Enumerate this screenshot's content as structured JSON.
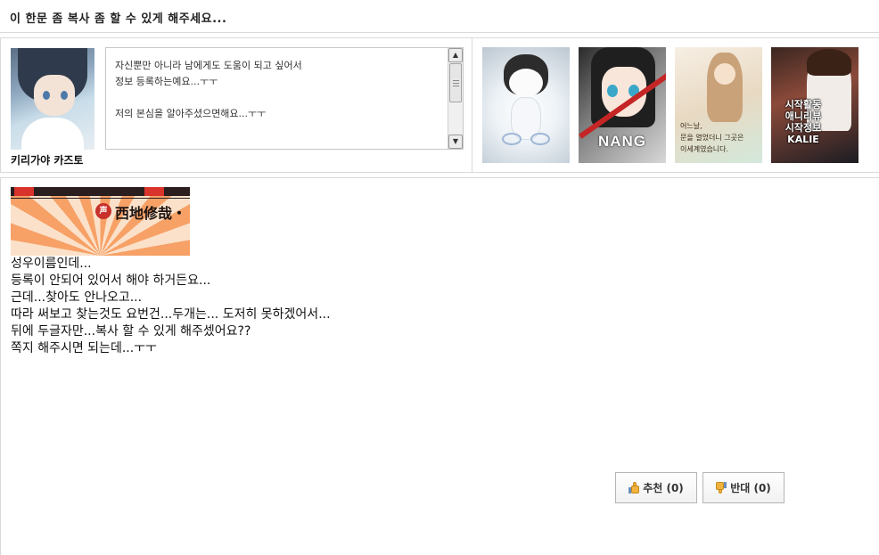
{
  "title": "이 한문 좀 복사 좀 할 수 있게 해주세요...",
  "profile": {
    "name": "키리가야 카즈토",
    "intro": "자신뿐만 아니라 남에게도 도움이 되고 싶어서\n정보 등록하는예요...ㅜㅜ\n\n저의 본심을 알아주셨으면해요...ㅜㅜ"
  },
  "gallery": {
    "thumb2_text": "NANG",
    "thumb3_text": "어느날,\n문을 열었더니 그곳은\n이세계였습니다.",
    "thumb4_text": "시작활동\n애니리뷰\n시작정보\nKALIE"
  },
  "post": {
    "banner_badge": "声",
    "banner_name": "西地修哉・",
    "body": "성우이름인데...\n등록이 안되어 있어서 해야 하거든요...\n근데...찾아도 안나오고...\n따라 써보고 찾는것도 요번건...두개는... 도저히 못하겠어서...\n뒤에 두글자만...복사 할 수 있게 해주셌어요??\n쪽지 해주시면 되는데...ㅜㅜ"
  },
  "votes": {
    "up_label": "추천 (0)",
    "down_label": "반대 (0)"
  },
  "icons": {
    "up": "thumbs-up-icon",
    "down": "thumbs-down-icon",
    "scroll_up": "scroll-up-arrow-icon",
    "scroll_down": "scroll-down-arrow-icon"
  },
  "colors": {
    "border": "#d9d9d9",
    "thumb_icon": "#f2b33d"
  }
}
